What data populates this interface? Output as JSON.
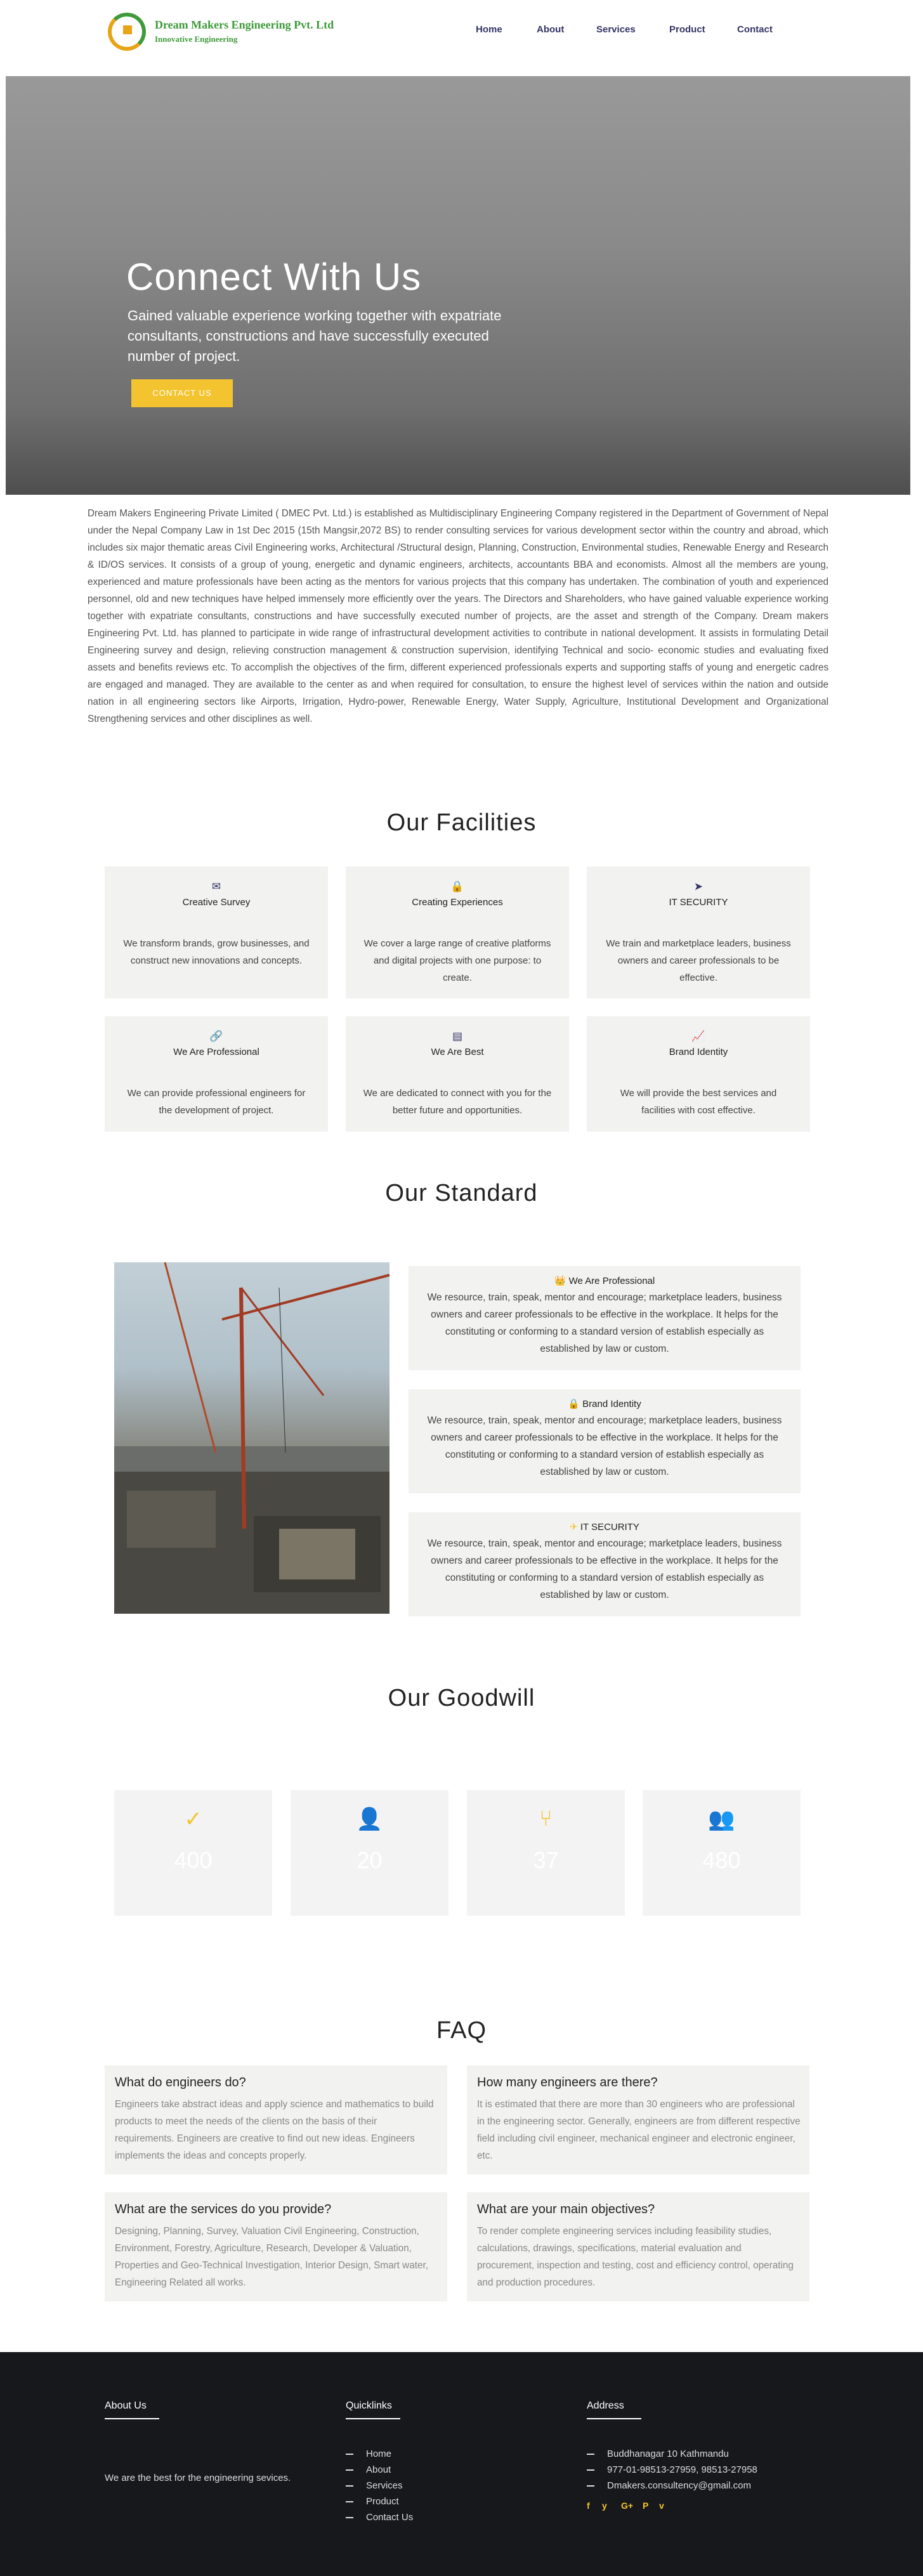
{
  "header": {
    "brand": "Dream Makers Engineering Pvt. Ltd",
    "tagline": "Innovative Engineering",
    "nav": [
      "Home",
      "About",
      "Services",
      "Product",
      "Contact"
    ]
  },
  "hero": {
    "title": "Connect With Us",
    "subtitle": "Gained valuable experience working together with expatriate consultants, constructions and have successfully executed number of project.",
    "cta": "CONTACT US"
  },
  "intro": "Dream Makers Engineering Private Limited ( DMEC Pvt. Ltd.) is established as Multidisciplinary Engineering Company registered in the Department of Government of Nepal under the Nepal Company Law in 1st Dec 2015 (15th Mangsir,2072 BS) to render consulting services for various development sector within the country and abroad, which includes six major thematic areas Civil Engineering works, Architectural /Structural design, Planning, Construction, Environmental studies, Renewable Energy and Research & ID/OS services. It consists of a group of young, energetic and dynamic engineers, architects, accountants BBA and economists. Almost all the members are young, experienced and mature professionals have been acting as the mentors for various projects that this company has undertaken. The combination of youth and experienced personnel, old and new techniques have helped immensely more efficiently over the years. The Directors and Shareholders, who have gained valuable experience working together with expatriate consultants, constructions and have successfully executed number of projects, are the asset and strength of the Company. Dream makers Engineering Pvt. Ltd. has planned to participate in wide range of infrastructural development activities to contribute in national development. It assists in formulating Detail Engineering survey and design, relieving construction management & construction supervision, identifying Technical and socio- economic studies and evaluating fixed assets and benefits reviews etc. To accomplish the objectives of the firm, different experienced professionals experts and supporting staffs of young and energetic cadres are engaged and managed. They are available to the center as and when required for consultation, to ensure the highest level of services within the nation and outside nation in all engineering sectors like Airports, Irrigation, Hydro-power, Renewable Energy, Water Supply, Agriculture, Institutional Development and Organizational Strengthening services and other disciplines as well.",
  "facilities": {
    "title": "Our Facilities",
    "items": [
      {
        "icon": "envelope-icon",
        "glyph": "✉",
        "title": "Creative Survey",
        "desc": "We transform brands, grow businesses, and construct new innovations and concepts."
      },
      {
        "icon": "lock-icon",
        "glyph": "🔒",
        "title": "Creating Experiences",
        "desc": "We cover a large range of creative platforms and digital projects with one purpose: to create."
      },
      {
        "icon": "paper-plane-icon",
        "glyph": "➤",
        "title": "IT SECURITY",
        "desc": "We train and marketplace leaders, business owners and career professionals to be effective."
      },
      {
        "icon": "link-icon",
        "glyph": "🔗",
        "title": "We Are Professional",
        "desc": "We can provide professional engineers for the development of project."
      },
      {
        "icon": "archive-icon",
        "glyph": "▤",
        "title": "We Are Best",
        "desc": "We are dedicated to connect with you for the better future and opportunities."
      },
      {
        "icon": "line-chart-icon",
        "glyph": "📈",
        "title": "Brand Identity",
        "desc": "We will provide the best services and facilities with cost effective."
      }
    ]
  },
  "standard": {
    "title": "Our Standard",
    "items": [
      {
        "emoji": "👑",
        "title": "We Are Professional",
        "desc": "We resource, train, speak, mentor and encourage; marketplace leaders, business owners and career professionals to be effective in the workplace. It helps for the constituting or conforming to a standard version of establish especially as established by law or custom."
      },
      {
        "emoji": "🔒",
        "title": "Brand Identity",
        "desc": "We resource, train, speak, mentor and encourage; marketplace leaders, business owners and career professionals to be effective in the workplace. It helps for the constituting or conforming to a standard version of establish especially as established by law or custom."
      },
      {
        "emoji": "✈",
        "title": "IT SECURITY",
        "desc": "We resource, train, speak, mentor and encourage; marketplace leaders, business owners and career professionals to be effective in the workplace. It helps for the constituting or conforming to a standard version of establish especially as established by law or custom."
      }
    ]
  },
  "goodwill": {
    "title": "Our Goodwill",
    "items": [
      {
        "icon": "check-circle-icon",
        "glyph": "✓",
        "number": "400"
      },
      {
        "icon": "user-icon",
        "glyph": "👤",
        "number": "20"
      },
      {
        "icon": "branch-icon",
        "glyph": "⑂",
        "number": "37"
      },
      {
        "icon": "users-icon",
        "glyph": "👥",
        "number": "480"
      }
    ]
  },
  "faq": {
    "title": "FAQ",
    "items": [
      {
        "q": "What do engineers do?",
        "a": "Engineers take abstract ideas and apply science and mathematics to build products to meet the needs of the clients on the basis of their requirements. Engineers are creative to find out new ideas. Engineers implements the ideas and concepts properly."
      },
      {
        "q": "How many engineers are there?",
        "a": "It is estimated that there are more than 30 engineers who are professional in the engineering sector. Generally, engineers are from different respective field including civil engineer, mechanical engineer and electronic engineer, etc."
      },
      {
        "q": "What are the services do you provide?",
        "a": "Designing, Planning, Survey, Valuation Civil Engineering, Construction, Environment, Forestry, Agriculture, Research, Developer & Valuation, Properties and Geo-Technical Investigation, Interior Design, Smart water, Engineering Related all works."
      },
      {
        "q": "What are your main objectives?",
        "a": "To render complete engineering services including feasibility studies, calculations, drawings, specifications, material evaluation and procurement, inspection and testing, cost and efficiency control, operating and production procedures."
      }
    ]
  },
  "footer": {
    "about_title": "About Us",
    "about_text": "We are the best for the engineering sevices.",
    "quicklinks_title": "Quicklinks",
    "quicklinks": [
      "Home",
      "About",
      "Services",
      "Product",
      "Contact Us"
    ],
    "address_title": "Address",
    "address_lines": [
      "Buddhanagar 10 Kathmandu",
      "977-01-98513-27959, 98513-27958",
      "Dmakers.consultency@gmail.com"
    ],
    "social": [
      "f",
      "y",
      "G+",
      "P",
      "v"
    ]
  },
  "colors": {
    "accent": "#f4c430",
    "brand_green": "#3e9a3a",
    "nav_text": "#333366",
    "footer_bg": "#17181c"
  }
}
